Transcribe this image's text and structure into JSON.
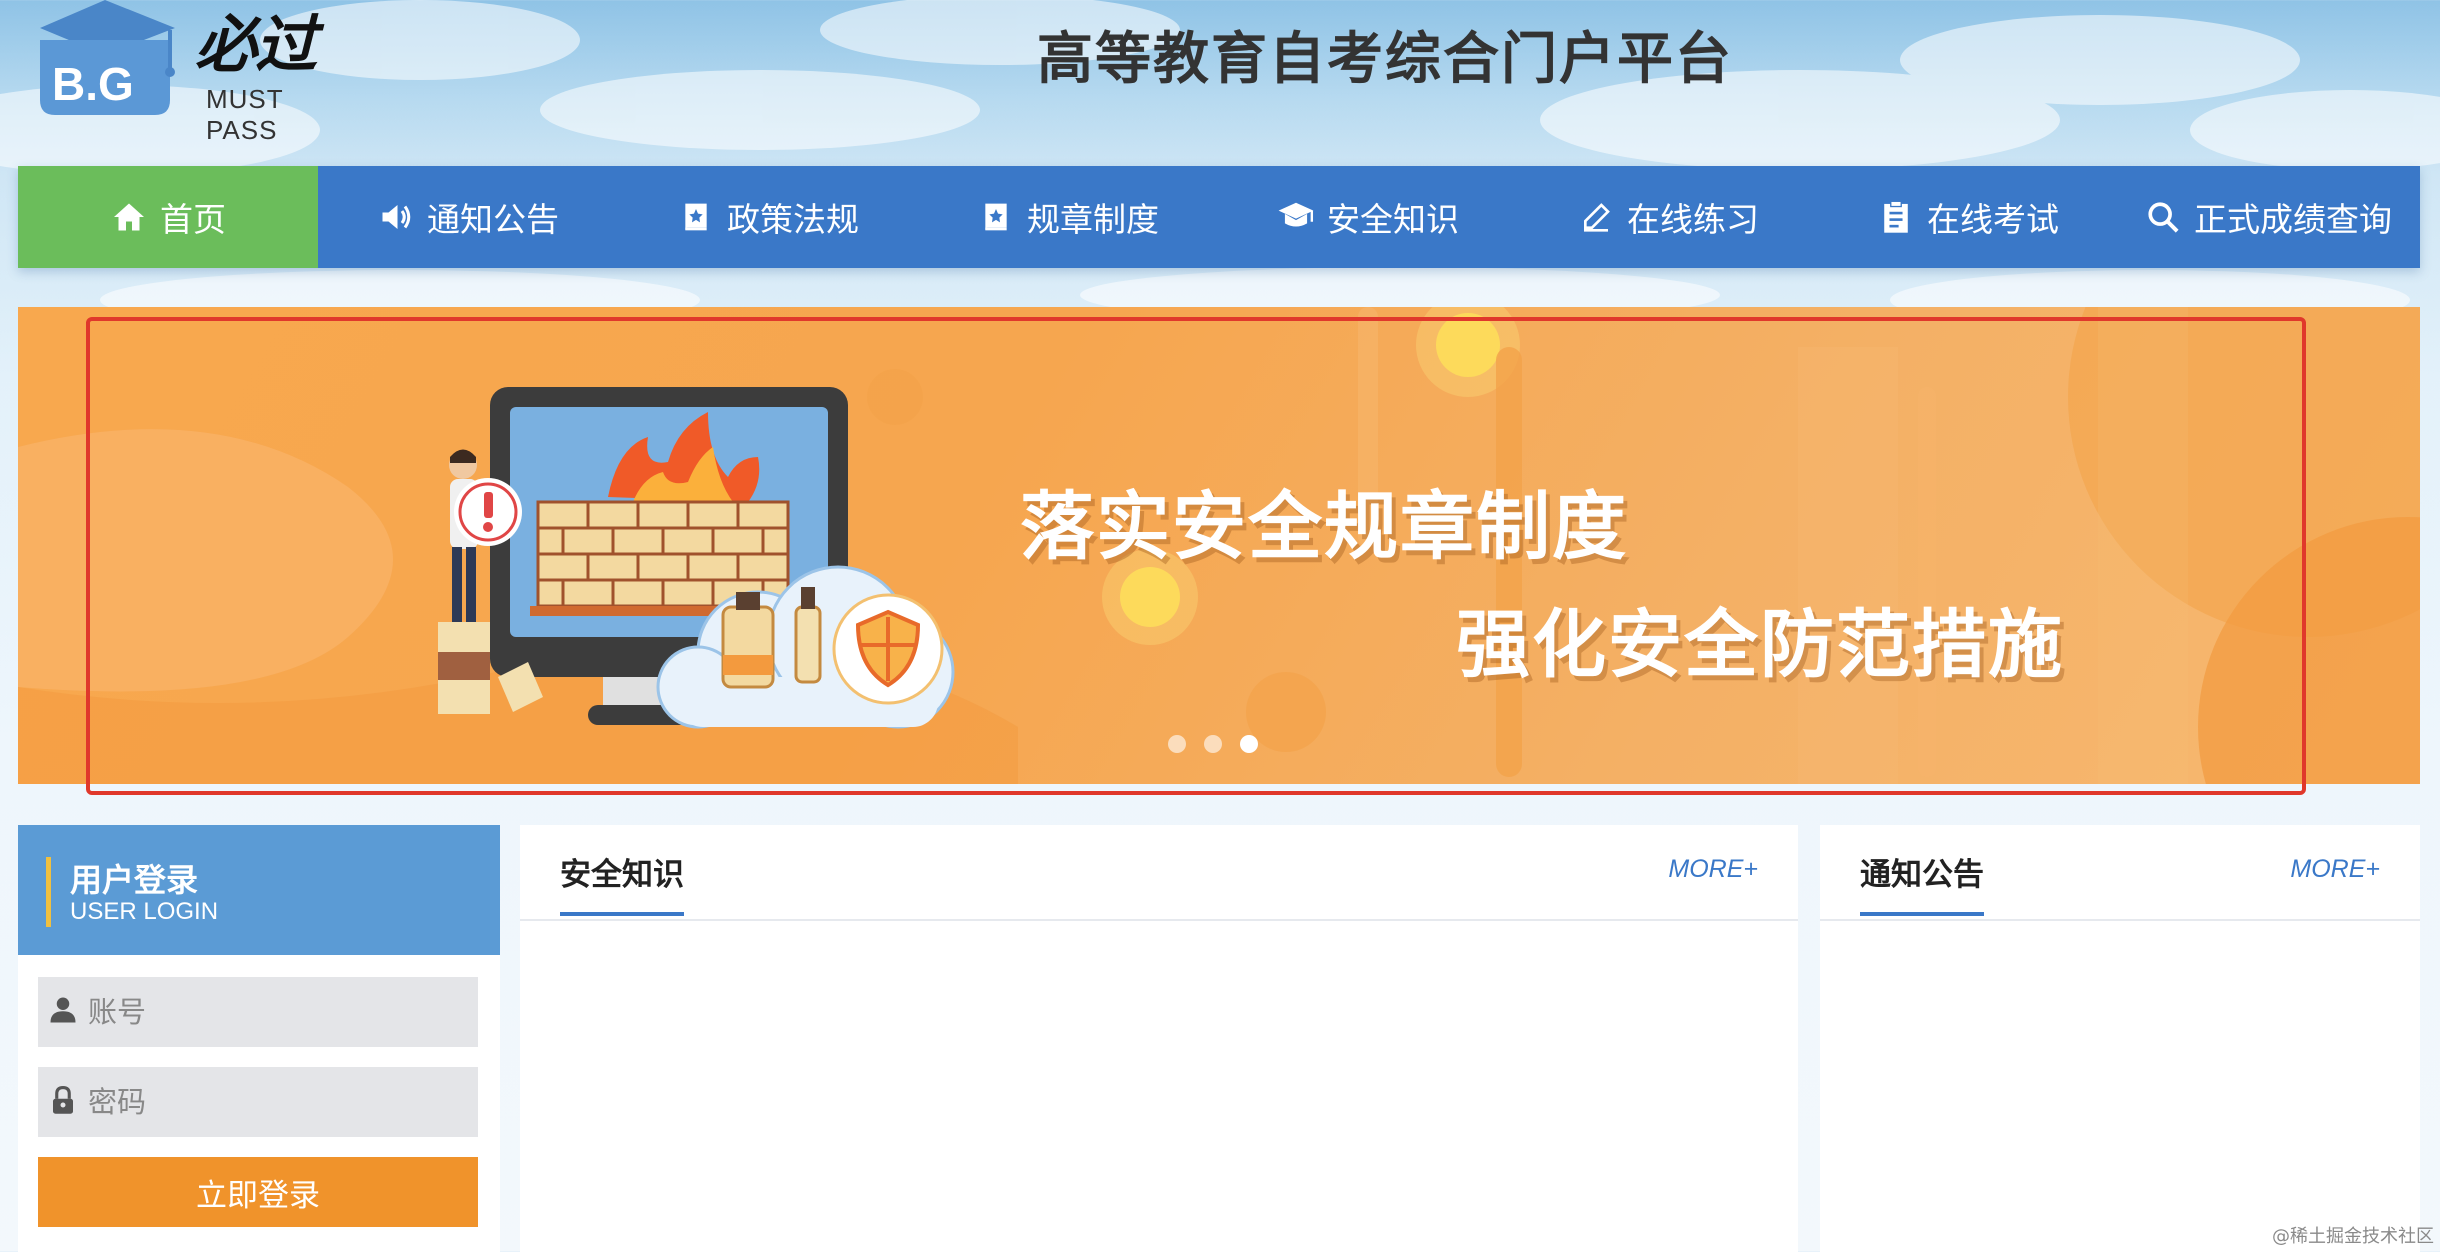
{
  "header": {
    "logo_cn": "必过",
    "logo_en": "MUST PASS",
    "logo_badge": "B.G",
    "site_title": "高等教育自考综合门户平台"
  },
  "nav": {
    "items": [
      {
        "label": "首页",
        "icon": "home-icon",
        "active": true
      },
      {
        "label": "通知公告",
        "icon": "speaker-icon"
      },
      {
        "label": "政策法规",
        "icon": "book-icon"
      },
      {
        "label": "规章制度",
        "icon": "book-icon"
      },
      {
        "label": "安全知识",
        "icon": "graduation-cap-icon"
      },
      {
        "label": "在线练习",
        "icon": "pen-icon"
      },
      {
        "label": "在线考试",
        "icon": "clipboard-icon"
      },
      {
        "label": "正式成绩查询",
        "icon": "search-icon"
      }
    ],
    "active_color": "#6bbd5b",
    "bar_color": "#3a78c8"
  },
  "banner": {
    "line1": "落实安全规章制度",
    "line2": "强化安全防范措施",
    "slide_count": 3,
    "active_slide": 3,
    "highlight_color": "#e0382b"
  },
  "login": {
    "title": "用户登录",
    "subtitle": "USER LOGIN",
    "username_placeholder": "账号",
    "password_placeholder": "密码",
    "submit_label": "立即登录"
  },
  "panels": {
    "safety": {
      "title": "安全知识",
      "more": "MORE+"
    },
    "notice": {
      "title": "通知公告",
      "more": "MORE+"
    }
  },
  "watermark": "@稀土掘金技术社区"
}
